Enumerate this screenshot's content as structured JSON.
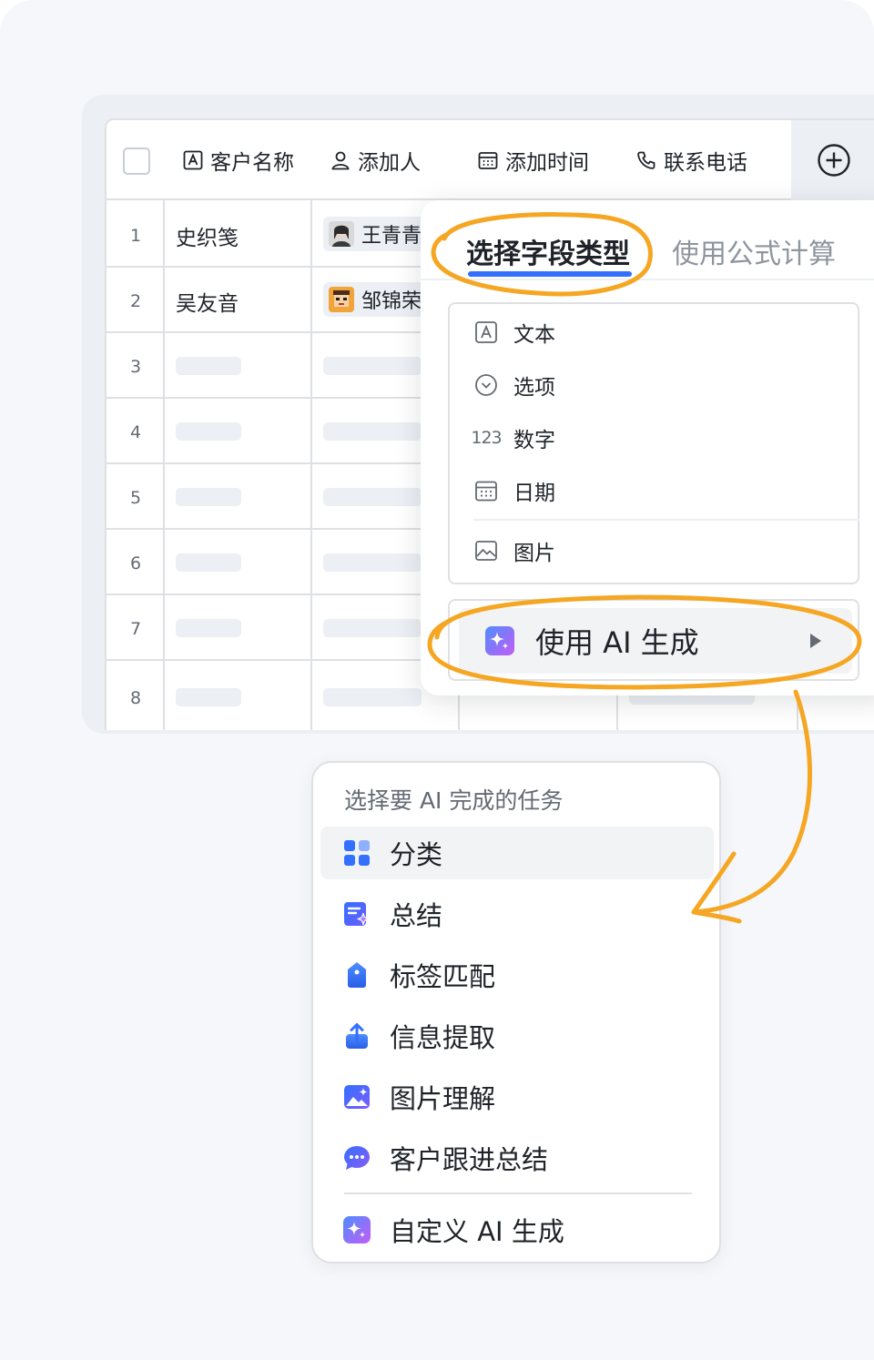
{
  "table": {
    "headers": [
      "客户名称",
      "添加人",
      "添加时间",
      "联系电话"
    ],
    "rows": [
      {
        "num": "1",
        "name": "史织笺",
        "person": "王青青"
      },
      {
        "num": "2",
        "name": "吴友音",
        "person": "邹锦荣"
      },
      {
        "num": "3"
      },
      {
        "num": "4"
      },
      {
        "num": "5"
      },
      {
        "num": "6"
      },
      {
        "num": "7"
      },
      {
        "num": "8"
      }
    ]
  },
  "field_popup": {
    "tab_active": "选择字段类型",
    "tab_inactive": "使用公式计算",
    "items": [
      {
        "icon": "text-field-icon",
        "label": "文本"
      },
      {
        "icon": "option-circle-icon",
        "label": "选项"
      },
      {
        "icon": "number-123-icon",
        "label": "数字",
        "icon_text": "123"
      },
      {
        "icon": "calendar-icon",
        "label": "日期"
      },
      {
        "icon": "image-icon",
        "label": "图片"
      }
    ],
    "ai_label": "使用 AI 生成"
  },
  "ai_popup": {
    "title": "选择要 AI 完成的任务",
    "tasks": [
      {
        "icon": "grid-classify-icon",
        "label": "分类"
      },
      {
        "icon": "summary-doc-icon",
        "label": "总结"
      },
      {
        "icon": "tag-icon",
        "label": "标签匹配"
      },
      {
        "icon": "upload-extract-icon",
        "label": "信息提取"
      },
      {
        "icon": "picture-understand-icon",
        "label": "图片理解"
      },
      {
        "icon": "chat-bubble-icon",
        "label": "客户跟进总结"
      }
    ],
    "custom_label": "自定义 AI 生成"
  },
  "colors": {
    "highlight_ring": "#f5a623",
    "accent_blue": "#3370ff"
  }
}
